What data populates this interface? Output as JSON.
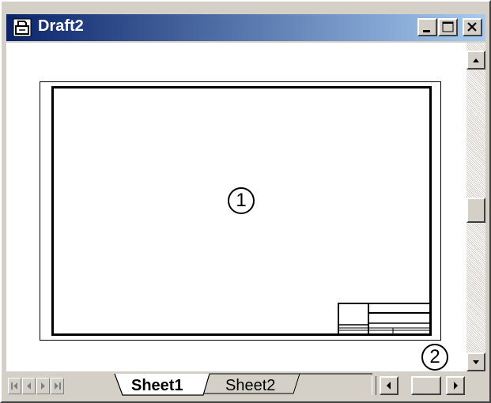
{
  "window": {
    "title": "Draft2",
    "app_icon": "draft-document-icon",
    "controls": [
      "minimize-icon",
      "maximize-icon",
      "close-icon"
    ]
  },
  "drawing": {
    "callout_1": "1",
    "callout_2": "2"
  },
  "sheet_tabs": {
    "nav_icons": [
      "first-sheet-icon",
      "previous-sheet-icon",
      "next-sheet-icon",
      "last-sheet-icon"
    ],
    "tabs": [
      {
        "label": "Sheet1",
        "active": true
      },
      {
        "label": "Sheet2",
        "active": false
      }
    ]
  },
  "scrollbars": {
    "vertical_icons": [
      "scroll-up-icon",
      "scroll-down-icon"
    ],
    "horizontal_icons": [
      "scroll-left-icon",
      "scroll-right-icon"
    ]
  }
}
